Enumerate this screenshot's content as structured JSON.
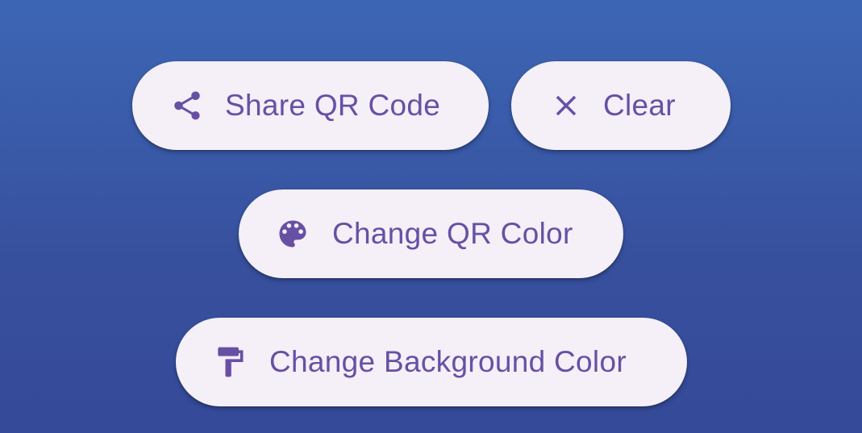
{
  "buttons": {
    "share": {
      "label": "Share QR Code",
      "icon": "share-icon"
    },
    "clear": {
      "label": "Clear",
      "icon": "close-icon"
    },
    "change_qr_color": {
      "label": "Change QR Color",
      "icon": "palette-icon"
    },
    "change_background_color": {
      "label": "Change Background Color",
      "icon": "format-paint-icon"
    }
  },
  "colors": {
    "button_background": "#f5eff7",
    "accent": "#6750a4",
    "page_background_top": "#3c66b4",
    "page_background_bottom": "#354a98"
  }
}
